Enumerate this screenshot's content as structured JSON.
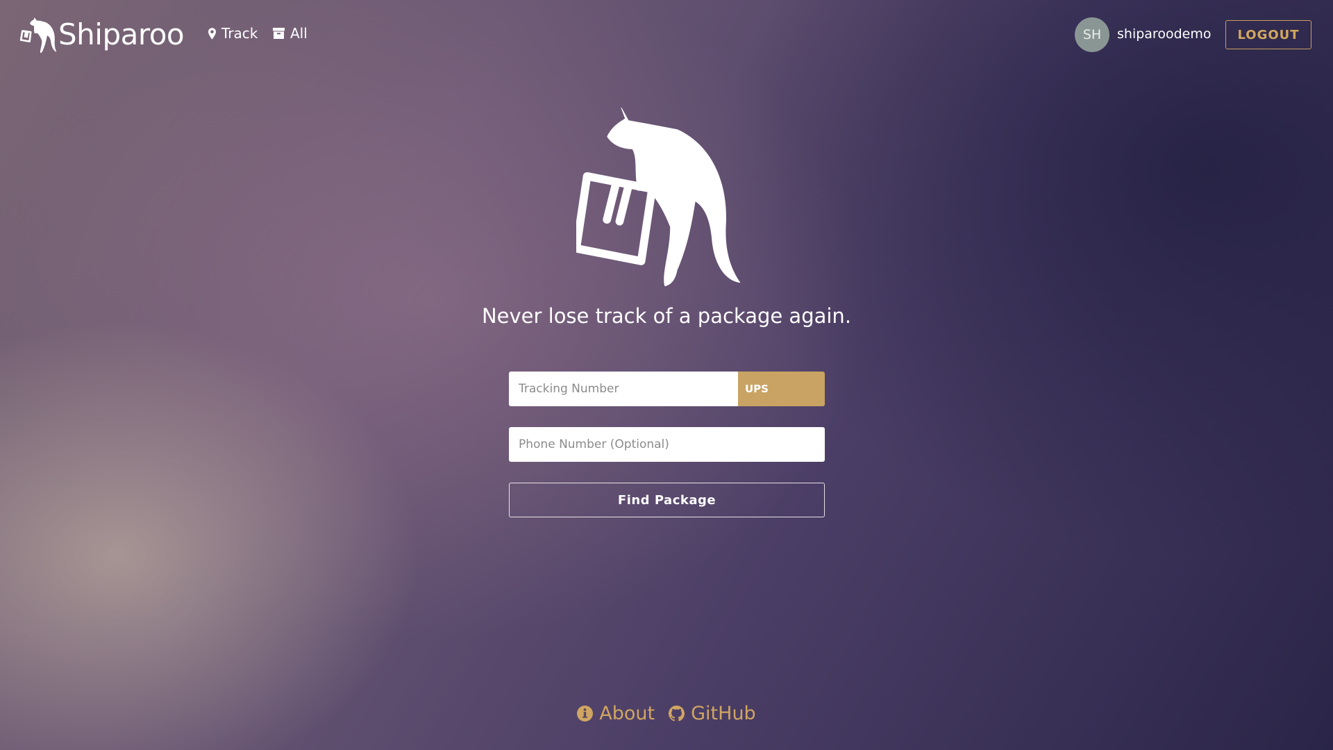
{
  "app": {
    "brand": "Shiparoo"
  },
  "nav": {
    "track_label": "Track",
    "all_label": "All"
  },
  "user": {
    "initials": "SH",
    "username": "shiparoodemo",
    "logout_label": "LOGOUT"
  },
  "hero": {
    "tagline": "Never lose track of a package again.",
    "icon": "kangaroo-package-icon"
  },
  "form": {
    "tracking_placeholder": "Tracking Number",
    "tracking_value": "",
    "carrier_selected": "UPS",
    "phone_placeholder": "Phone Number (Optional)",
    "phone_value": "",
    "submit_label": "Find Package"
  },
  "footer": {
    "about_label": "About",
    "github_label": "GitHub"
  },
  "colors": {
    "accent": "#c9a364",
    "link": "#d0a562",
    "avatar_bg": "#8a9694"
  }
}
